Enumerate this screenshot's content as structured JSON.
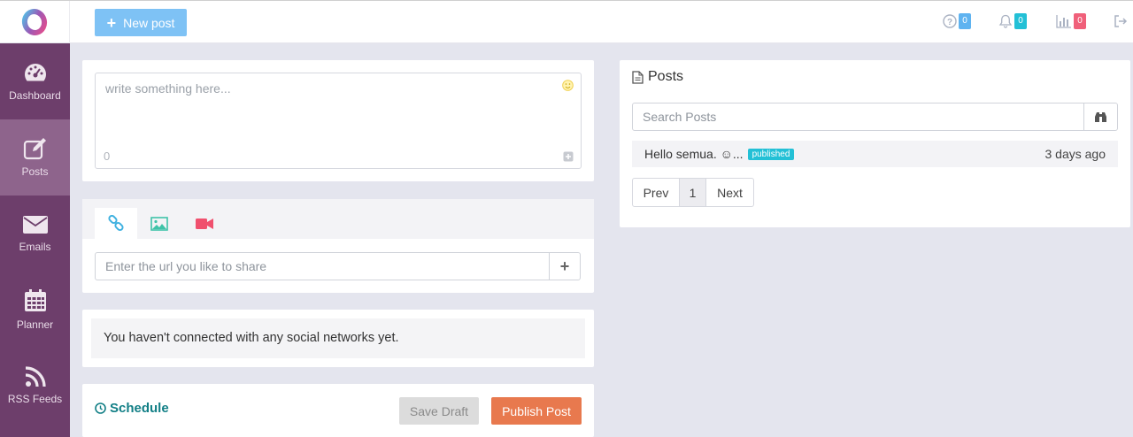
{
  "topbar": {
    "new_post_label": "New post",
    "badges": [
      {
        "icon": "question-icon",
        "count": "0",
        "color": "#5fb3f0"
      },
      {
        "icon": "bell-icon",
        "count": "0",
        "color": "#23c0d6"
      },
      {
        "icon": "bar-chart-icon",
        "count": "0",
        "color": "#f0607a"
      }
    ]
  },
  "sidebar": {
    "items": [
      {
        "label": "Dashboard",
        "icon": "dashboard-icon"
      },
      {
        "label": "Posts",
        "icon": "edit-icon",
        "active": true
      },
      {
        "label": "Emails",
        "icon": "envelope-icon"
      },
      {
        "label": "Planner",
        "icon": "calendar-icon"
      },
      {
        "label": "RSS Feeds",
        "icon": "rss-icon"
      }
    ]
  },
  "composer": {
    "placeholder": "write something here...",
    "char_count": "0"
  },
  "media": {
    "tabs": [
      "link",
      "image",
      "video"
    ],
    "url_placeholder": "Enter the url you like to share"
  },
  "networks": {
    "message": "You haven't connected with any social networks yet."
  },
  "schedule": {
    "label": "Schedule",
    "save_draft": "Save Draft",
    "publish": "Publish Post"
  },
  "posts_panel": {
    "title": "Posts",
    "search_placeholder": "Search Posts",
    "items": [
      {
        "text": "Hello semua. ☺...",
        "status": "published",
        "time": "3 days ago"
      }
    ],
    "pager": {
      "prev": "Prev",
      "page": "1",
      "next": "Next"
    }
  },
  "colors": {
    "sidebar": "#6d3e6b",
    "sidebar_active": "#8e648c",
    "new_post": "#7ec2f5",
    "publish": "#e8794e",
    "schedule": "#127f86",
    "published_badge": "#23c0d6"
  }
}
